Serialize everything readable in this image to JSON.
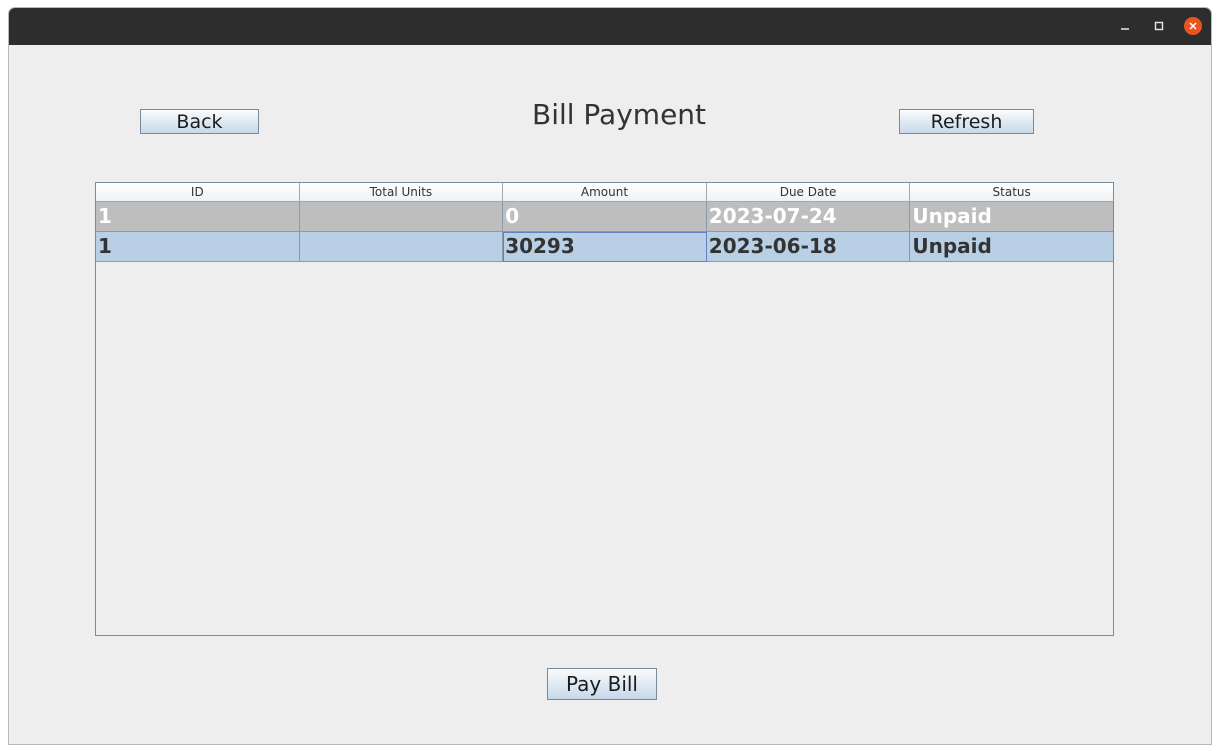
{
  "window": {
    "controls": {
      "minimize": "–",
      "maximize": "□",
      "close": "✕"
    }
  },
  "header": {
    "title": "Bill Payment",
    "back_label": "Back",
    "refresh_label": "Refresh"
  },
  "table": {
    "columns": [
      "ID",
      "Total Units",
      "Amount",
      "Due Date",
      "Status"
    ],
    "rows": [
      {
        "id": "1",
        "total_units": "",
        "amount": "0",
        "due_date": "2023-07-24",
        "status": "Unpaid"
      },
      {
        "id": "1",
        "total_units": "",
        "amount": "30293",
        "due_date": "2023-06-18",
        "status": "Unpaid"
      }
    ]
  },
  "footer": {
    "pay_label": "Pay Bill"
  },
  "colors": {
    "titlebar": "#2e2d2d",
    "close_button": "#e9541f",
    "selected_row": "#b8cfe5",
    "alt_row": "#bebebe"
  }
}
